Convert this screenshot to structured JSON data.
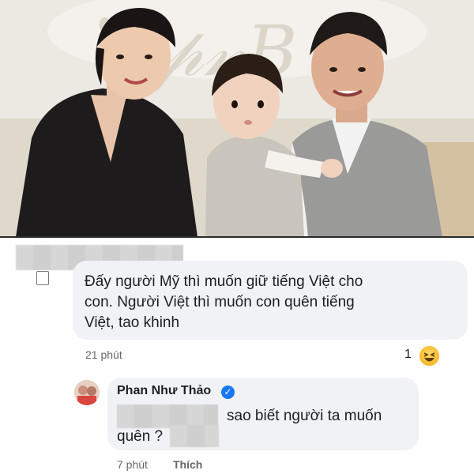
{
  "comment1": {
    "line1": "Đấy người Mỹ thì muốn giữ tiếng Việt cho",
    "line2": "con. Người Việt thì muốn con quên tiếng",
    "line3": "Việt, tao khinh",
    "time": "21 phút",
    "reaction_count": "1",
    "reaction_icon": "haha-icon"
  },
  "comment2": {
    "author": "Phan Như Thảo",
    "verified_icon": "verified-badge-icon",
    "line1": "sao biết người ta muốn",
    "line2": "quên ?",
    "time": "7 phút",
    "like_label": "Thích"
  },
  "colors": {
    "bubble": "#f0f2f5",
    "meta": "#65676b",
    "verified": "#1877f2"
  }
}
